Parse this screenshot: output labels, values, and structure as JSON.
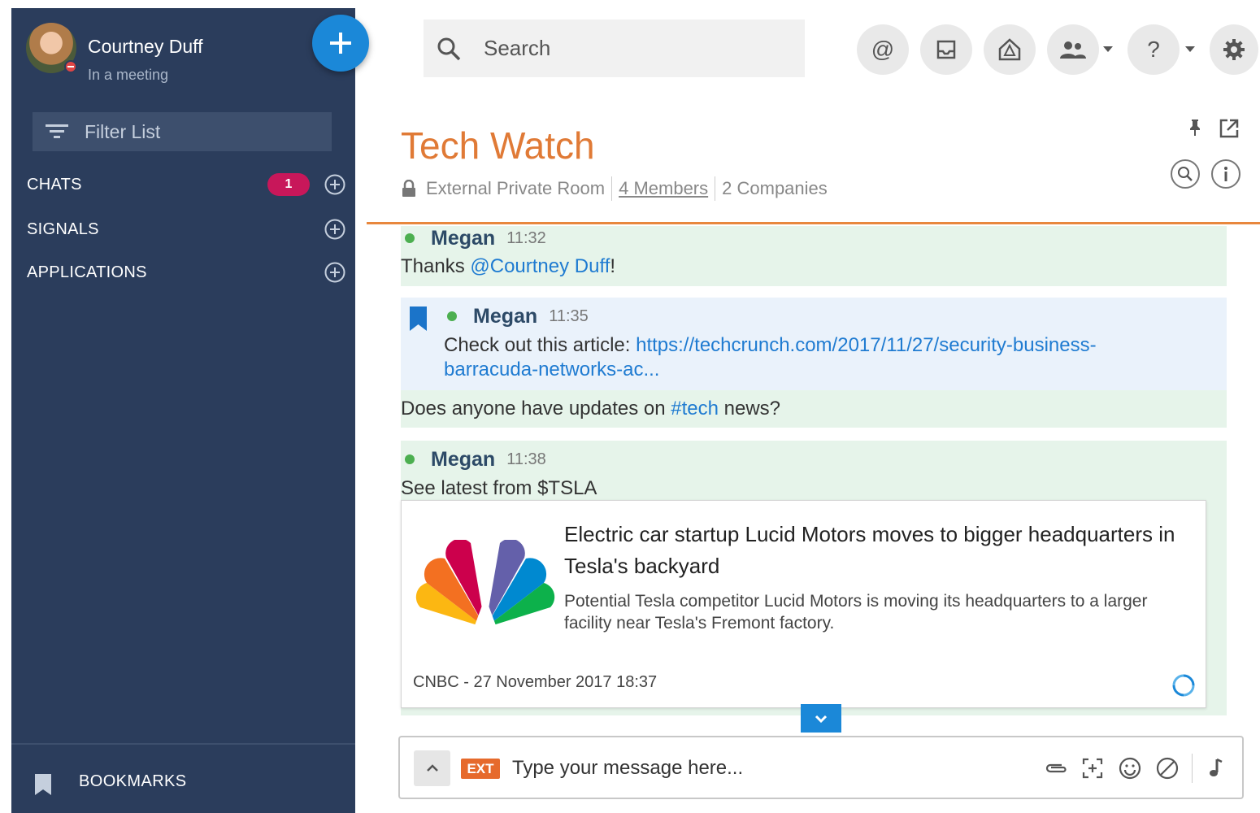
{
  "user": {
    "name": "Courtney Duff",
    "status": "In a meeting"
  },
  "sidebar": {
    "filter_label": "Filter List",
    "sections": [
      {
        "label": "CHATS",
        "badge": "1"
      },
      {
        "label": "SIGNALS"
      },
      {
        "label": "APPLICATIONS"
      }
    ],
    "footer_label": "BOOKMARKS"
  },
  "search": {
    "placeholder": "Search"
  },
  "room": {
    "title": "Tech Watch",
    "privacy": "External Private Room",
    "members": "4 Members",
    "companies": "2 Companies"
  },
  "messages": [
    {
      "author": "Megan",
      "time": "11:32",
      "text_before": "Thanks ",
      "mention": "@Courtney Duff",
      "text_after": "!"
    },
    {
      "author": "Megan",
      "time": "11:35",
      "text": "Check out this article: ",
      "link_line1": "https://techcrunch.com/2017/11/27/security-business-",
      "link_line2": "barracuda-networks-ac...",
      "followup_before": "Does anyone have updates on ",
      "followup_tag": "#tech",
      "followup_after": " news?"
    },
    {
      "author": "Megan",
      "time": "11:38",
      "text": "See latest from $TSLA"
    }
  ],
  "news_card": {
    "title": "Electric car startup Lucid Motors moves to bigger headquarters in Tesla's backyard",
    "description": "Potential Tesla competitor Lucid Motors is moving its headquarters to a larger facility near Tesla's Fremont factory.",
    "source": "CNBC - 27 November 2017 18:37"
  },
  "composer": {
    "ext_label": "EXT",
    "placeholder": "Type your message here..."
  },
  "colors": {
    "sidebar": "#2b3d5c",
    "accent_blue": "#1b88d8",
    "room_title": "#e07a36",
    "badge": "#c8175a",
    "ext": "#e66a2c"
  },
  "icons": {
    "topbar": [
      "at-icon",
      "inbox-icon",
      "home-icon",
      "people-icon",
      "help-icon",
      "gear-icon"
    ],
    "header": [
      "pin-icon",
      "popout-icon",
      "search-icon",
      "info-icon"
    ],
    "composer": [
      "attach-icon",
      "screenshot-icon",
      "emoji-icon",
      "block-icon",
      "audio-icon"
    ]
  }
}
